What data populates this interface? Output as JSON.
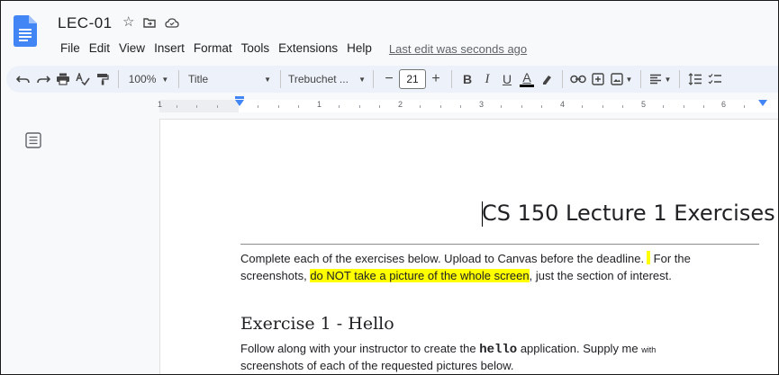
{
  "doc": {
    "title": "LEC-01",
    "menus": [
      "File",
      "Edit",
      "View",
      "Insert",
      "Format",
      "Tools",
      "Extensions",
      "Help"
    ],
    "last_edit": "Last edit was seconds ago"
  },
  "toolbar": {
    "zoom": "100%",
    "style": "Title",
    "font": "Trebuchet ...",
    "font_size": "21",
    "minus": "−",
    "plus": "+",
    "bold": "B",
    "italic": "I",
    "underline": "U",
    "text_color": "A"
  },
  "ruler": {
    "numbers": [
      "1",
      "1",
      "2",
      "3",
      "4",
      "5",
      "6"
    ]
  },
  "content": {
    "heading": "CS 150 Lecture 1 Exercises",
    "intro_line1_a": "Complete each of the exercises below. Upload to Canvas before the deadline.",
    "intro_line1_b": " For the",
    "intro_line2_a": "screenshots, ",
    "intro_line2_hl": "do NOT take a picture of the whole screen",
    "intro_line2_b": ", just the section of interest.",
    "exercise_heading": "Exercise 1 - Hello",
    "ex_line1_a": "Follow along with your instructor to create the ",
    "ex_line1_code": "hello",
    "ex_line1_b": " application. Supply me ",
    "ex_line1_tiny": "with",
    "ex_line2": "screenshots of each of the requested pictures below."
  },
  "colors": {
    "accent": "#4285f4",
    "highlight": "#ffff00",
    "toolbar_bg": "#edf2fa"
  }
}
